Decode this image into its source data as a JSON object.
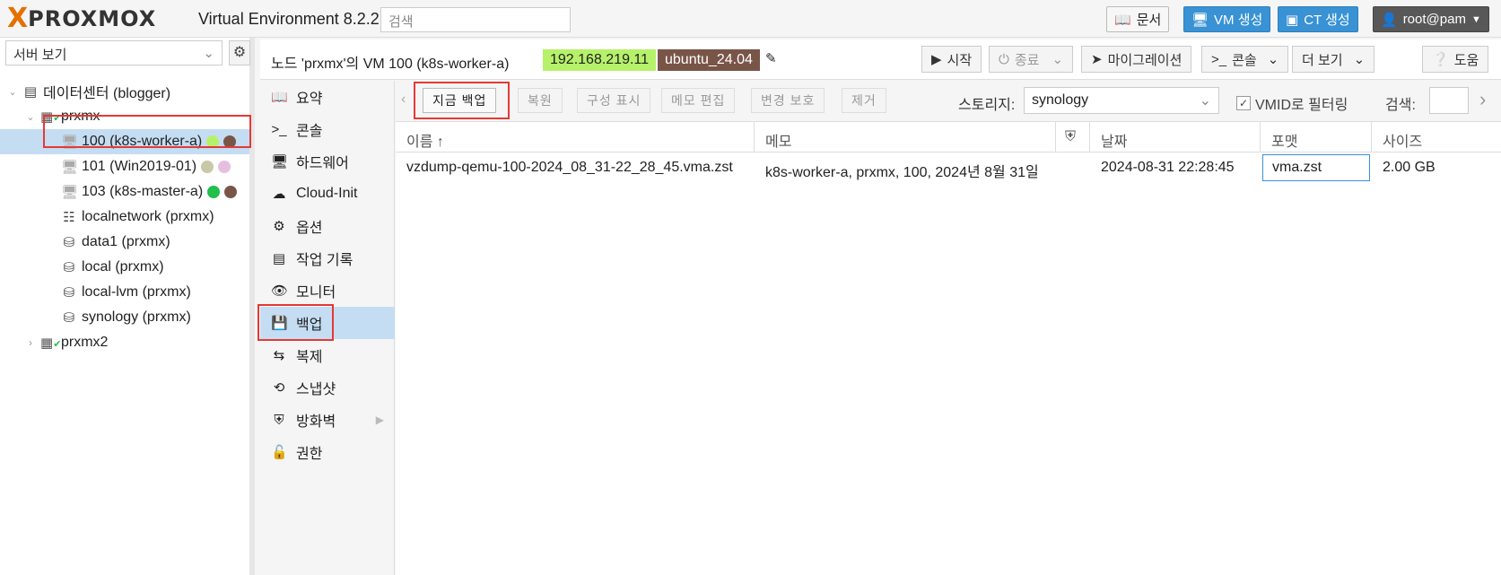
{
  "topbar": {
    "logo_x": "X",
    "logo_text": "PROXMOX",
    "product": "Virtual Environment 8.2.2",
    "search_placeholder": "검색",
    "docs": "문서",
    "create_vm": "VM 생성",
    "create_ct": "CT 생성",
    "user": "root@pam"
  },
  "sidebar": {
    "view": "서버 보기",
    "nodes": [
      {
        "label": "데이터센터 (blogger)",
        "icon": "datacenter-icon"
      },
      {
        "label": "prxmx",
        "icon": "node-icon"
      },
      {
        "label": "100 (k8s-worker-a)",
        "icon": "vm-icon",
        "selected": true
      },
      {
        "label": "101 (Win2019-01)",
        "icon": "vm-icon"
      },
      {
        "label": "103 (k8s-master-a)",
        "icon": "vm-icon"
      },
      {
        "label": "localnetwork (prxmx)",
        "icon": "network-icon"
      },
      {
        "label": "data1 (prxmx)",
        "icon": "storage-icon"
      },
      {
        "label": "local (prxmx)",
        "icon": "storage-icon"
      },
      {
        "label": "local-lvm (prxmx)",
        "icon": "storage-icon"
      },
      {
        "label": "synology (prxmx)",
        "icon": "storage-icon"
      },
      {
        "label": "prxmx2",
        "icon": "node-icon"
      }
    ]
  },
  "vm": {
    "title": "노드 'prxmx'의 VM 100 (k8s-worker-a)",
    "tag_ip": "192.168.219.11",
    "tag_os": "ubuntu_24.04",
    "btn_start": "시작",
    "btn_shutdown": "종료",
    "btn_migrate": "마이그레이션",
    "btn_console": "콘솔",
    "btn_more": "더 보기",
    "btn_help": "도움",
    "colors": {
      "ip_tag": "#b6f16a",
      "os_tag": "#795548",
      "accent": "#3892d4"
    }
  },
  "menu": [
    {
      "label": "요약",
      "icon": "summary-icon"
    },
    {
      "label": "콘솔",
      "icon": "console-icon"
    },
    {
      "label": "하드웨어",
      "icon": "hardware-icon"
    },
    {
      "label": "Cloud-Init",
      "icon": "cloud-icon"
    },
    {
      "label": "옵션",
      "icon": "options-icon"
    },
    {
      "label": "작업 기록",
      "icon": "task-history-icon"
    },
    {
      "label": "모니터",
      "icon": "monitor-icon"
    },
    {
      "label": "백업",
      "icon": "backup-icon",
      "selected": true
    },
    {
      "label": "복제",
      "icon": "replication-icon"
    },
    {
      "label": "스냅샷",
      "icon": "snapshot-icon"
    },
    {
      "label": "방화벽",
      "icon": "firewall-icon"
    },
    {
      "label": "권한",
      "icon": "permissions-icon"
    }
  ],
  "backup": {
    "btn_backup_now": "지금 백업",
    "btn_restore": "복원",
    "btn_show_config": "구성 표시",
    "btn_edit_notes": "메모 편집",
    "btn_protect": "변경 보호",
    "btn_remove": "제거",
    "storage_label": "스토리지:",
    "storage_value": "synology",
    "vmid_filter": "VMID로 필터링",
    "search_label": "검색:",
    "columns": {
      "name": "이름 ↑",
      "notes": "메모",
      "protected": "",
      "date": "날짜",
      "format": "포맷",
      "size": "사이즈"
    },
    "rows": [
      {
        "name": "vzdump-qemu-100-2024_08_31-22_28_45.vma.zst",
        "notes": "k8s-worker-a, prxmx, 100, 2024년 8월 31일",
        "date": "2024-08-31 22:28:45",
        "format": "vma.zst",
        "size": "2.00 GB"
      }
    ]
  }
}
